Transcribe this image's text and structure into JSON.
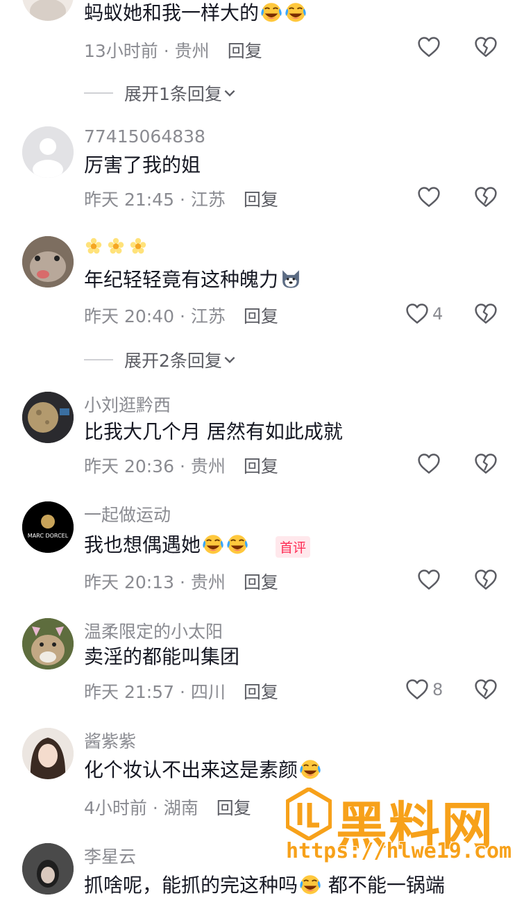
{
  "comments": [
    {
      "text": "蚂蚁她和我一样大的",
      "time": "13小时前",
      "location": "贵州",
      "reply_label": "回复",
      "expand_label": "展开1条回复"
    },
    {
      "username": "77415064838",
      "text": "厉害了我的姐",
      "time": "昨天 21:45",
      "location": "江苏",
      "reply_label": "回复"
    },
    {
      "text": "年纪轻轻竟有这种魄力",
      "time": "昨天 20:40",
      "location": "江苏",
      "reply_label": "回复",
      "like_count": "4",
      "expand_label": "展开2条回复"
    },
    {
      "username": "小刘逛黔西",
      "text": "比我大几个月 居然有如此成就",
      "time": "昨天 20:36",
      "location": "贵州",
      "reply_label": "回复"
    },
    {
      "username": "一起做运动",
      "text": "我也想偶遇她",
      "badge": "首评",
      "time": "昨天 20:13",
      "location": "贵州",
      "reply_label": "回复",
      "avatar_text": "MARC DORCEL"
    },
    {
      "username": "温柔限定的小太阳",
      "text": "卖淫的都能叫集团",
      "time": "昨天 21:57",
      "location": "四川",
      "reply_label": "回复",
      "like_count": "8"
    },
    {
      "username": "酱紫紫",
      "text": "化个妆认不出来这是素颜",
      "time": "4小时前",
      "location": "湖南",
      "reply_label": "回复"
    },
    {
      "username": "李星云",
      "text": "抓啥呢，能抓的完这种吗",
      "text_tail": "都不能一锅端"
    }
  ],
  "separator": "·",
  "watermark": {
    "title": "黑料网",
    "url": "https://hlwe19.com"
  },
  "colors": {
    "username": "#8a8b91",
    "text": "#161823",
    "badge": "#fe2c55",
    "watermark": "#f7a11a"
  },
  "icons": [
    "heart-icon",
    "broken-heart-icon",
    "chevron-down-icon",
    "laughing-crying-emoji",
    "husky-emoji",
    "flower-emoji"
  ]
}
